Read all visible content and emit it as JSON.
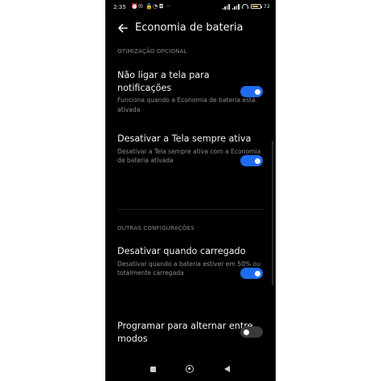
{
  "status_bar": {
    "time": "2:35",
    "notification_icons": [
      "alarm-icon",
      "mail-icon",
      "lock-icon",
      "messenger-icon",
      "instagram-icon",
      "more-dots"
    ],
    "battery_text": "72"
  },
  "header": {
    "title": "Economia de bateria",
    "back_icon": "arrow-left-icon"
  },
  "sections": [
    {
      "label": "OTIMIZAÇÃO OPCIONAL",
      "items": [
        {
          "title": "Não ligar a tela para notificações",
          "description": "Funciona quando a Economia de bateria está ativada",
          "enabled": true
        },
        {
          "title": "Desativar a Tela sempre ativa",
          "description": "Desativar a Tela sempre ativa com a Economia de bateria ativada",
          "enabled": true
        }
      ]
    },
    {
      "label": "OUTRAS CONFIGURAÇÕES",
      "items": [
        {
          "title": "Desativar quando carregado",
          "description": "Desativar quando a bateria estiver em 50% ou totalmente carregada",
          "enabled": true
        },
        {
          "title": "Programar para alternar entre modos",
          "description": "",
          "enabled": false
        }
      ]
    }
  ],
  "colors": {
    "background": "#000000",
    "toggle_on": "#1f6cf0",
    "toggle_off": "#3a3a3a",
    "section_label": "#8a8a8a"
  }
}
